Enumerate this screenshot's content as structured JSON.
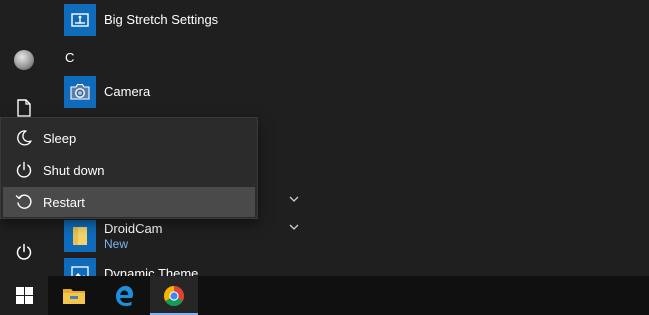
{
  "app_list": {
    "items": [
      {
        "label": "Big Stretch Settings",
        "icon": "big-stretch-icon"
      },
      {
        "label": "Camera",
        "icon": "camera-icon"
      },
      {
        "label": "DroidCam",
        "icon": "folder-icon",
        "badge": "New"
      },
      {
        "label": "Dynamic Theme",
        "icon": "dynamic-theme-icon"
      }
    ],
    "section_letter": "C"
  },
  "power_menu": {
    "items": [
      {
        "label": "Sleep",
        "icon": "moon-icon"
      },
      {
        "label": "Shut down",
        "icon": "power-icon"
      },
      {
        "label": "Restart",
        "icon": "restart-icon",
        "highlighted": true
      }
    ]
  },
  "left_rail": {
    "items": [
      "user-avatar",
      "documents-icon",
      "power-icon"
    ]
  },
  "taskbar": {
    "items": [
      "windows-start-icon",
      "file-explorer-icon",
      "edge-icon",
      "chrome-icon"
    ],
    "active": "chrome-icon"
  },
  "colors": {
    "accent": "#0f6cbd",
    "badge": "#7cb3f3",
    "menu_bg": "#1f1f1f",
    "flyout_bg": "#2b2b2b",
    "highlight": "#4a4a4a",
    "taskbar_bg": "#101010"
  }
}
